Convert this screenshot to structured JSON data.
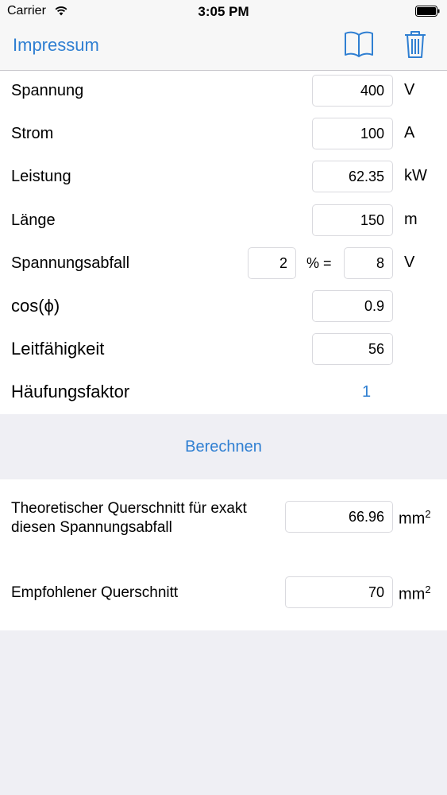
{
  "status": {
    "carrier": "Carrier",
    "time": "3:05 PM"
  },
  "nav": {
    "left_link": "Impressum",
    "book_icon": "book-icon",
    "trash_icon": "trash-icon"
  },
  "form": {
    "spannung": {
      "label": "Spannung",
      "value": "400",
      "unit": "V"
    },
    "strom": {
      "label": "Strom",
      "value": "100",
      "unit": "A"
    },
    "leistung": {
      "label": "Leistung",
      "value": "62.35",
      "unit": "kW"
    },
    "laenge": {
      "label": "Länge",
      "value": "150",
      "unit": "m"
    },
    "spannungsabfall": {
      "label": "Spannungsabfall",
      "percent": "2",
      "eq": "% =",
      "volts": "8",
      "unit": "V"
    },
    "cos": {
      "label": "cos(ϕ)",
      "value": "0.9"
    },
    "leitfaehigkeit": {
      "label": "Leitfähigkeit",
      "value": "56"
    },
    "haeufung": {
      "label": "Häufungsfaktor",
      "value": "1"
    }
  },
  "calculate_label": "Berechnen",
  "results": {
    "theoretical": {
      "line1": "Theoretischer Querschnitt für exakt",
      "line2": "diesen Spannungsabfall",
      "value": "66.96",
      "unit": "mm",
      "unit_sup": "2"
    },
    "recommended": {
      "label": "Empfohlener Querschnitt",
      "value": "70",
      "unit": "mm",
      "unit_sup": "2"
    }
  },
  "colors": {
    "accent": "#2f7fd2",
    "background": "#efeff4"
  }
}
